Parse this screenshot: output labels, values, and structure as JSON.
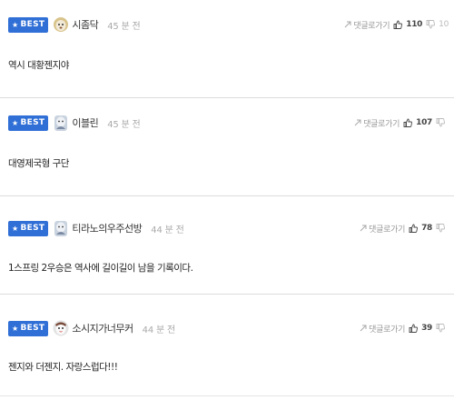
{
  "comments": [
    {
      "badge": "BEST",
      "nickname": "시좀닥",
      "time": "45 분 전",
      "reply_label": "댓글로가기",
      "likes": "110",
      "dislikes": "10",
      "text": "역시 대황젠지야"
    },
    {
      "badge": "BEST",
      "nickname": "이블린",
      "time": "45 분 전",
      "reply_label": "댓글로가기",
      "likes": "107",
      "dislikes": "",
      "text": "대영제국형 구단"
    },
    {
      "badge": "BEST",
      "nickname": "티라노의우주선방",
      "time": "44 분 전",
      "reply_label": "댓글로가기",
      "likes": "78",
      "dislikes": "",
      "text": "1스프링 2우승은 역사에 길이길이 남을 기록이다."
    },
    {
      "badge": "BEST",
      "nickname": "소시지가너무커",
      "time": "44 분 전",
      "reply_label": "댓글로가기",
      "likes": "39",
      "dislikes": "",
      "text": "젠지와 더젠지. 자랑스럽다!!!"
    }
  ],
  "colors": {
    "badge": "#2f6fd6",
    "divider": "#dcdcdc"
  },
  "icons": {
    "reply": "reply-arrow-icon",
    "like": "thumbs-up-icon",
    "dislike": "thumbs-down-icon"
  }
}
